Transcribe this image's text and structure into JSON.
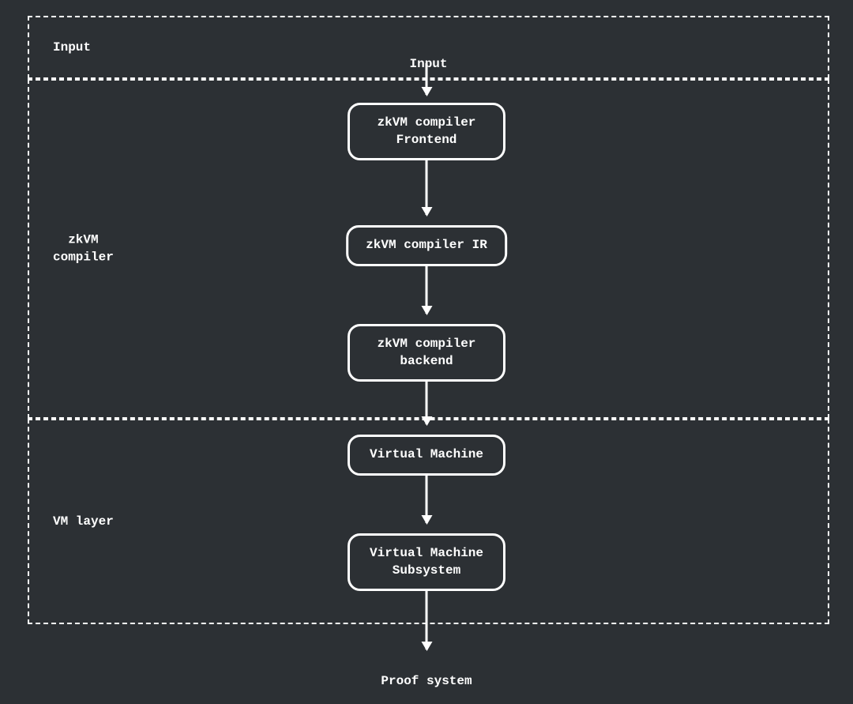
{
  "sections": {
    "input": {
      "label": "Input",
      "topLabel": "Input"
    },
    "compiler": {
      "label": "zkVM\ncompiler"
    },
    "vm": {
      "label": "VM layer"
    }
  },
  "nodes": {
    "frontend": "zkVM compiler\nFrontend",
    "ir": "zkVM compiler IR",
    "backend": "zkVM compiler\nbackend",
    "virtualMachine": "Virtual Machine",
    "vmSubsystem": "Virtual Machine\nSubsystem"
  },
  "output": "Proof system"
}
